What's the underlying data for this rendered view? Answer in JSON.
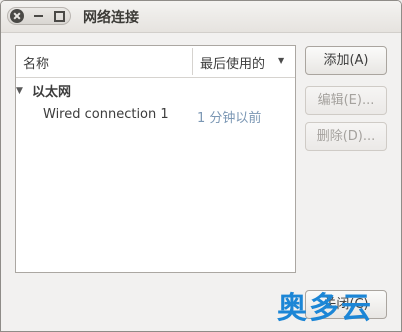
{
  "window": {
    "title": "网络连接"
  },
  "list": {
    "columns": [
      "名称",
      "最后使用的"
    ],
    "groups": [
      {
        "label": "以太网",
        "connections": [
          {
            "name": "Wired connection 1",
            "last_used": "1 分钟以前"
          }
        ]
      }
    ]
  },
  "buttons": {
    "add": "添加(A)",
    "edit": "编辑(E)...",
    "delete": "删除(D)...",
    "close": "关闭(C)"
  },
  "watermark": {
    "text": "奥多云"
  },
  "icons": {
    "close": "close-icon",
    "minimize": "minimize-icon",
    "maximize": "maximize-icon",
    "expander": "triangle-down-icon",
    "sort": "sort-down-icon"
  },
  "colors": {
    "accent": "#1c86d6",
    "time_text": "#7b97b4"
  }
}
